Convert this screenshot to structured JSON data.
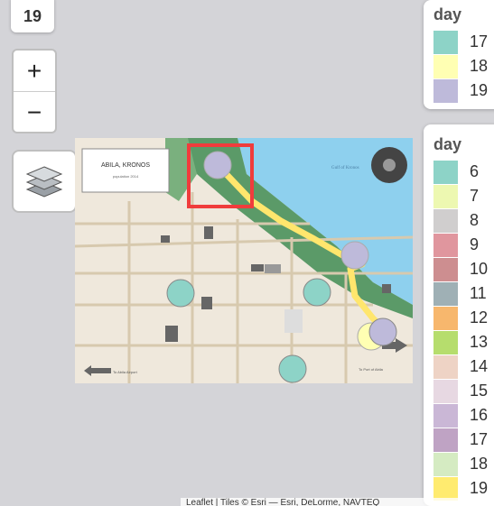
{
  "day_badge": "19",
  "zoom": {
    "in_label": "+",
    "out_label": "−"
  },
  "legend_top": {
    "title": "day",
    "items": [
      {
        "label": "17",
        "color": "#8dd3c7"
      },
      {
        "label": "18",
        "color": "#ffffb3"
      },
      {
        "label": "19",
        "color": "#bebada"
      }
    ]
  },
  "legend_bottom": {
    "title": "day",
    "items": [
      {
        "label": "6",
        "color": "#8dd3c7"
      },
      {
        "label": "7",
        "color": "#edf8b1"
      },
      {
        "label": "8",
        "color": "#d0cece"
      },
      {
        "label": "9",
        "color": "#e0969e"
      },
      {
        "label": "10",
        "color": "#cd8e90"
      },
      {
        "label": "11",
        "color": "#9fb0b5"
      },
      {
        "label": "12",
        "color": "#f7b76d"
      },
      {
        "label": "13",
        "color": "#b6dd6d"
      },
      {
        "label": "14",
        "color": "#eed3c5"
      },
      {
        "label": "15",
        "color": "#e7d8e2"
      },
      {
        "label": "16",
        "color": "#cab7d6"
      },
      {
        "label": "17",
        "color": "#bfa3c4"
      },
      {
        "label": "18",
        "color": "#d5ebc2"
      },
      {
        "label": "19",
        "color": "#ffeb6f"
      }
    ]
  },
  "map": {
    "title": "ABILA, KRONOS",
    "subtitle": "population 2014",
    "water_label": "Gulf of Kronos",
    "sign_airport": "To Abila Airport",
    "sign_elodis": "To Port of Abila",
    "route_color": "#ffe66d",
    "highlight_color": "#f03c3c"
  },
  "attribution": "Leaflet | Tiles © Esri — Esri, DeLorme, NAVTEQ"
}
